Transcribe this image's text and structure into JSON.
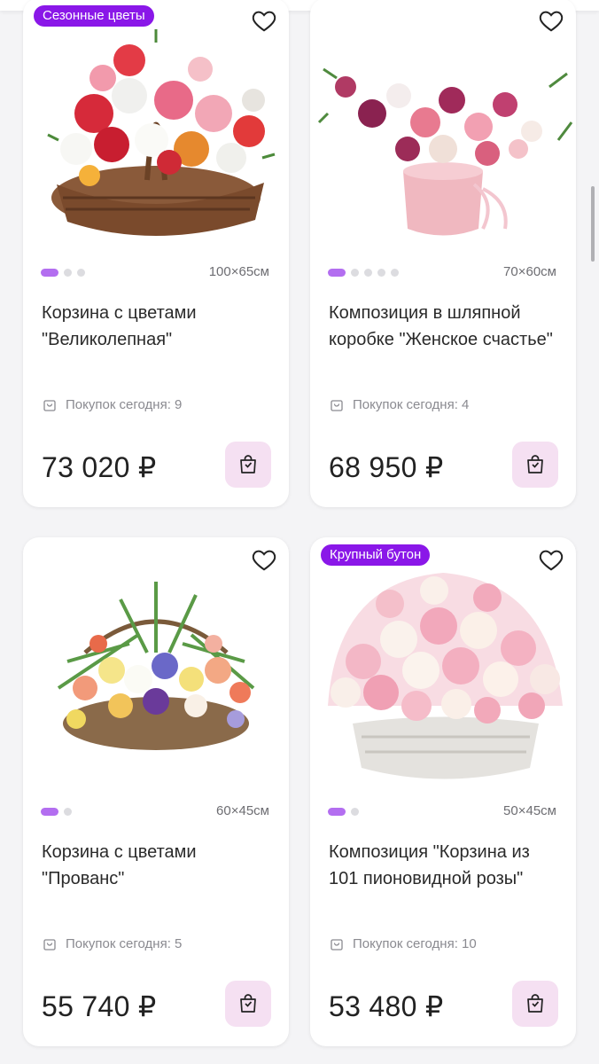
{
  "products": [
    {
      "badge": "Сезонные цветы",
      "size": "100×65см",
      "title": "Корзина с цветами \"Великолепная\"",
      "purchases": "Покупок сегодня: 9",
      "price": "73 020 ₽",
      "image_count": 3,
      "active_image": 1
    },
    {
      "badge": "",
      "size": "70×60см",
      "title": "Композиция в шляпной коробке \"Женское счастье\"",
      "purchases": "Покупок сегодня: 4",
      "price": "68 950 ₽",
      "image_count": 5,
      "active_image": 1
    },
    {
      "badge": "",
      "size": "60×45см",
      "title": "Корзина с цветами \"Прованс\"",
      "purchases": "Покупок сегодня: 5",
      "price": "55 740 ₽",
      "image_count": 2,
      "active_image": 1
    },
    {
      "badge": "Крупный бутон",
      "size": "50×45см",
      "title": "Композиция \"Корзина из 101 пионовидной розы\"",
      "purchases": "Покупок сегодня: 10",
      "price": "53 480 ₽",
      "image_count": 2,
      "active_image": 1
    }
  ],
  "colors": {
    "badge": "#8a17e8",
    "cart_bg": "#f5e0f2",
    "dot_active": "#b36ef0"
  },
  "icons": {
    "favorite": "heart-outline-icon",
    "cart": "shopping-bag-icon",
    "purchases": "bag-small-icon"
  }
}
